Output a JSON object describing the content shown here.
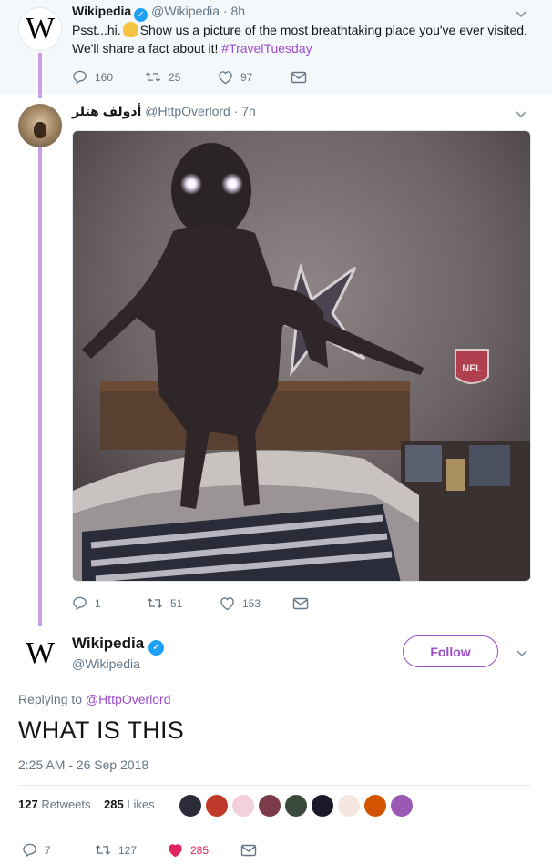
{
  "tweet1": {
    "name": "Wikipedia",
    "handle": "@Wikipedia",
    "time": "· 8h",
    "text_a": "Psst...hi.",
    "text_b": "Show us a picture of the most breathtaking place you've ever visited. We'll share a fact about it!",
    "hashtag": "#TravelTuesday",
    "replies": "160",
    "retweets": "25",
    "likes": "97"
  },
  "tweet2": {
    "name": "أدولف هتلر",
    "handle": "@HttpOverlord",
    "time": "· 7h",
    "replies": "1",
    "retweets": "51",
    "likes": "153",
    "image_logo": "NFL"
  },
  "main": {
    "name": "Wikipedia",
    "handle": "@Wikipedia",
    "follow_label": "Follow",
    "replying_prefix": "Replying to",
    "replying_to": "@HttpOverlord",
    "text": "WHAT IS THIS",
    "timestamp": "2:25 AM - 26 Sep 2018",
    "retweets_count": "127",
    "retweets_label": "Retweets",
    "likes_count": "285",
    "likes_label": "Likes",
    "reply_count": "7",
    "retweet_action_count": "127",
    "like_action_count": "285"
  },
  "avatar_letter": "W",
  "likers": [
    "#2b2b3a",
    "#c0392b",
    "#f3d1dc",
    "#7b3b4a",
    "#3a4a3a",
    "#1a1a2a",
    "#f5e6e0",
    "#d35400",
    "#9b59b6"
  ],
  "colors": {
    "accent": "#9b4dca",
    "verified": "#1da1f2",
    "like": "#e0245e",
    "muted": "#657786"
  }
}
